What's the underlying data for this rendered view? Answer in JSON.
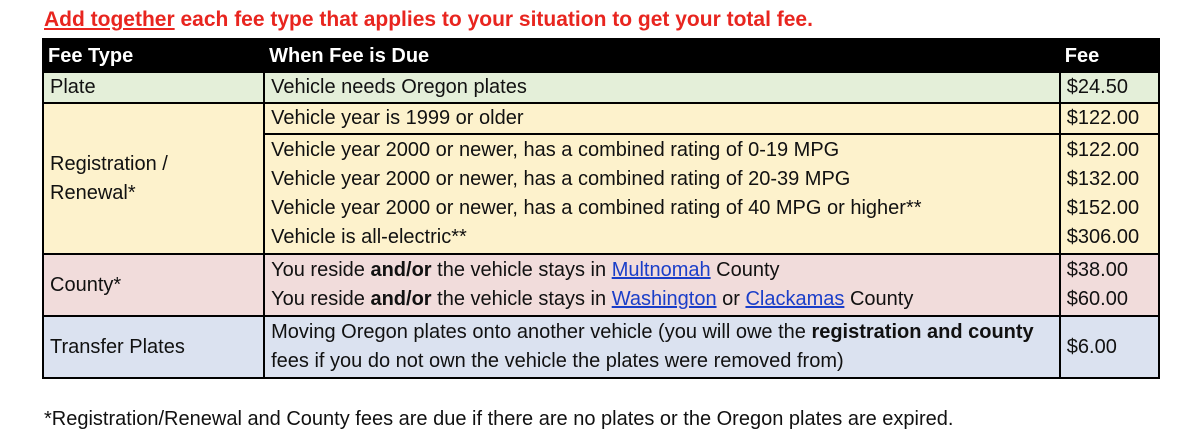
{
  "headline": {
    "emphasis": "Add together",
    "rest": " each fee type that applies to your situation to get your total fee."
  },
  "table": {
    "headers": {
      "fee_type": "Fee Type",
      "when_due": "When Fee is Due",
      "fee": "Fee"
    },
    "plate": {
      "type": "Plate",
      "when": "Vehicle needs Oregon plates",
      "fee": "$24.50"
    },
    "registration": {
      "type_line1": "Registration /",
      "type_line2": "Renewal*",
      "old": {
        "when": "Vehicle year is 1999 or older",
        "fee": "$122.00"
      },
      "newer": [
        {
          "when": "Vehicle year 2000 or newer, has a combined rating of 0-19 MPG",
          "fee": "$122.00"
        },
        {
          "when": "Vehicle year 2000 or newer, has a combined rating of 20-39 MPG",
          "fee": "$132.00"
        },
        {
          "when": "Vehicle year 2000 or newer, has a combined rating of 40 MPG or higher**",
          "fee": "$152.00"
        },
        {
          "when": "Vehicle is all-electric**",
          "fee": "$306.00"
        }
      ]
    },
    "county": {
      "type": "County*",
      "you_reside": "You reside ",
      "and_or": "and/or",
      "stays_in": " the vehicle stays in ",
      "or": " or ",
      "county_word": " County",
      "multnomah": "Multnomah",
      "washington": "Washington",
      "clackamas": "Clackamas",
      "fee1": "$38.00",
      "fee2": "$60.00"
    },
    "transfer": {
      "type": "Transfer Plates",
      "part1": "Moving Oregon plates onto another vehicle (you will owe the ",
      "bold1": "registration and county",
      "part2": " fees if you do not own the vehicle the plates were removed from)",
      "fee": "$6.00"
    }
  },
  "footnote": "*Registration/Renewal and County fees are due if there are no plates or the Oregon plates are expired."
}
